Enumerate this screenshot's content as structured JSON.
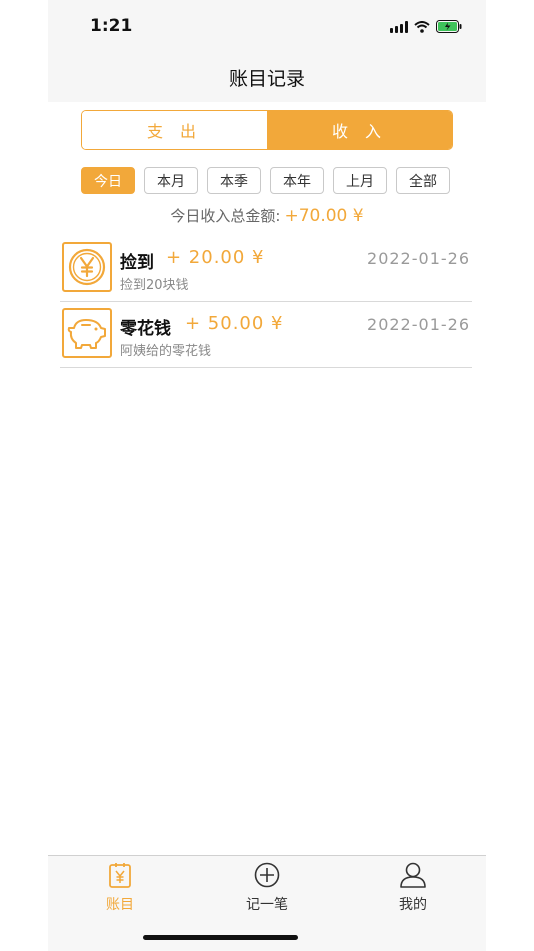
{
  "status_bar": {
    "time": "1:21"
  },
  "nav": {
    "title": "账目记录"
  },
  "segment": {
    "expense_label": "支 出",
    "income_label": "收 入",
    "selected": "income"
  },
  "filters": [
    {
      "label": "今日",
      "active": true
    },
    {
      "label": "本月",
      "active": false
    },
    {
      "label": "本季",
      "active": false
    },
    {
      "label": "本年",
      "active": false
    },
    {
      "label": "上月",
      "active": false
    },
    {
      "label": "全部",
      "active": false
    }
  ],
  "summary": {
    "label": "今日收入总金额:",
    "amount": "+70.00 ¥"
  },
  "records": [
    {
      "icon": "yen-coin-icon",
      "name": "捡到",
      "amount": "+ 20.00 ¥",
      "date": "2022-01-26",
      "note": "捡到20块钱"
    },
    {
      "icon": "piggy-bank-icon",
      "name": "零花钱",
      "amount": "+ 50.00 ¥",
      "date": "2022-01-26",
      "note": "阿姨给的零花钱"
    }
  ],
  "tabbar": {
    "items": [
      {
        "label": "账目",
        "icon": "ledger-icon",
        "active": true
      },
      {
        "label": "记一笔",
        "icon": "add-circle-icon",
        "active": false
      },
      {
        "label": "我的",
        "icon": "user-icon",
        "active": false
      }
    ]
  },
  "colors": {
    "accent": "#f2a83a",
    "text": "#222222",
    "muted": "#9a9a9a"
  }
}
